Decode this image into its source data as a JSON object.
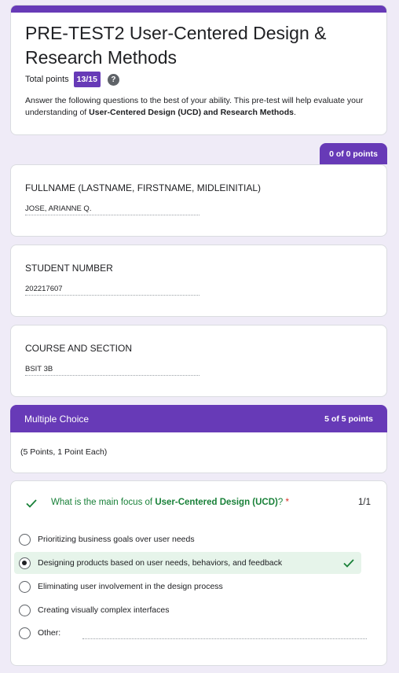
{
  "header": {
    "title": "PRE-TEST2 User-Centered Design & Research Methods",
    "total_points_label": "Total points",
    "score": "13/15",
    "help_icon": "?",
    "description_prefix": " Answer the following questions to the best of your ability. This pre-test will help evaluate your understanding of ",
    "description_bold": "User-Centered Design (UCD) and Research Methods",
    "description_suffix": "."
  },
  "section_points": "0 of 0 points",
  "fields": [
    {
      "label": "FULLNAME (LASTNAME, FIRSTNAME, MIDLEINITIAL)",
      "value": "JOSE, ARIANNE Q."
    },
    {
      "label": "STUDENT NUMBER",
      "value": "202217607"
    },
    {
      "label": "COURSE AND SECTION",
      "value": "BSIT 3B"
    }
  ],
  "section": {
    "title": "Multiple Choice",
    "points": "5 of 5 points",
    "description": "(5 Points, 1 Point Each)"
  },
  "question": {
    "text_prefix": "What is the main focus of ",
    "text_bold": "User-Centered Design (UCD)",
    "text_suffix": "?",
    "required_marker": " *",
    "score": "1/1",
    "options": [
      "Prioritizing business goals over user needs",
      "Designing products based on user needs, behaviors, and feedback",
      "Eliminating user involvement in the design process",
      "Creating visually complex interfaces",
      "Other:"
    ],
    "selected_index": 1
  },
  "colors": {
    "accent": "#673ab7",
    "background": "#efebf7",
    "correct_green": "#188038",
    "correct_bg": "#e6f4ea",
    "required_red": "#d93025"
  }
}
